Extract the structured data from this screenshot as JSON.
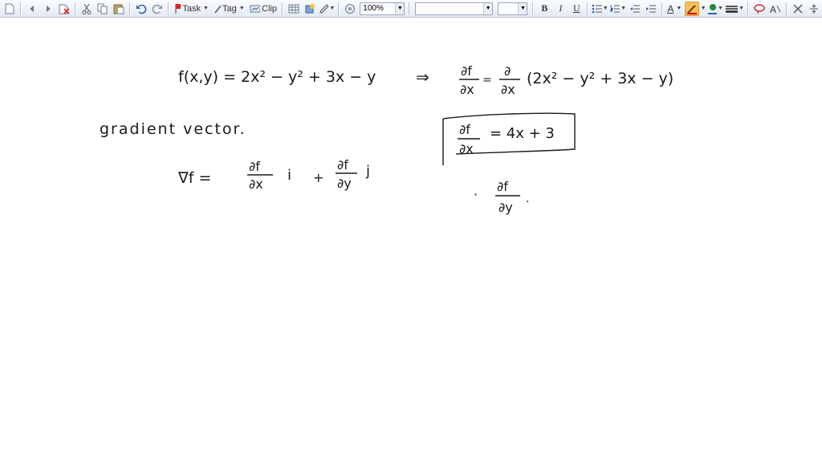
{
  "toolbar": {
    "task_label": "Task",
    "tag_label": "Tag",
    "clip_label": "Clip",
    "zoom_value": "100%",
    "bold_label": "B",
    "italic_label": "I",
    "underline_label": "U",
    "font_color_glyph": "A",
    "accent_highlight": "#f6c15a"
  },
  "notes": {
    "eq1_lhs": "f(x,y) = 2x² − y² + 3x − y",
    "eq1_implies": "⇒",
    "eq1_rhs_expr": "(2x² − y² + 3x − y)",
    "df_num": "∂f",
    "dx_den": "∂x",
    "d_num": "∂",
    "dy_den": "∂y",
    "equals": "=",
    "gradient_heading": "gradient vector.",
    "nabla_f": "∇f =",
    "i_vec": "i",
    "plus": "+",
    "j_vec": "j",
    "boxed_result": "= 4x + 3",
    "dot": "·"
  }
}
